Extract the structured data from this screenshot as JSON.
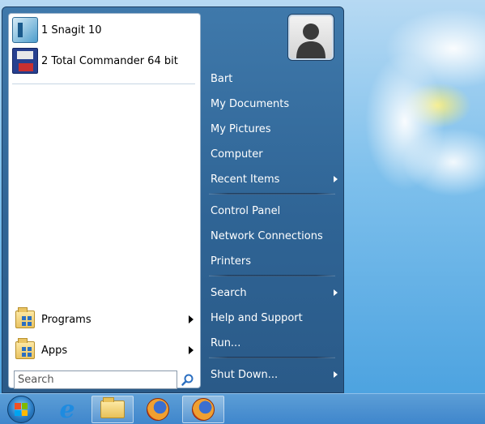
{
  "pinned": [
    {
      "label": "1 Snagit 10",
      "icon": "snagit-icon"
    },
    {
      "label": "2 Total Commander 64 bit",
      "icon": "total-commander-icon"
    }
  ],
  "folders": [
    {
      "label": "Programs",
      "icon": "programs-folder-icon"
    },
    {
      "label": "Apps",
      "icon": "apps-folder-icon"
    }
  ],
  "search": {
    "placeholder": "Search"
  },
  "right": {
    "user": "Bart",
    "my_documents": "My Documents",
    "my_pictures": "My Pictures",
    "computer": "Computer",
    "recent_items": "Recent Items",
    "control_panel": "Control Panel",
    "network_connections": "Network Connections",
    "printers": "Printers",
    "search": "Search",
    "help_and_support": "Help and Support",
    "run": "Run...",
    "shut_down": "Shut Down..."
  },
  "taskbar": {
    "items": [
      "start-button",
      "internet-explorer",
      "file-explorer",
      "firefox",
      "firefox"
    ]
  },
  "colors": {
    "menu_background": "#2f6495",
    "taskbar": "#4a8fd0",
    "wallpaper": "#6fb3e6"
  }
}
